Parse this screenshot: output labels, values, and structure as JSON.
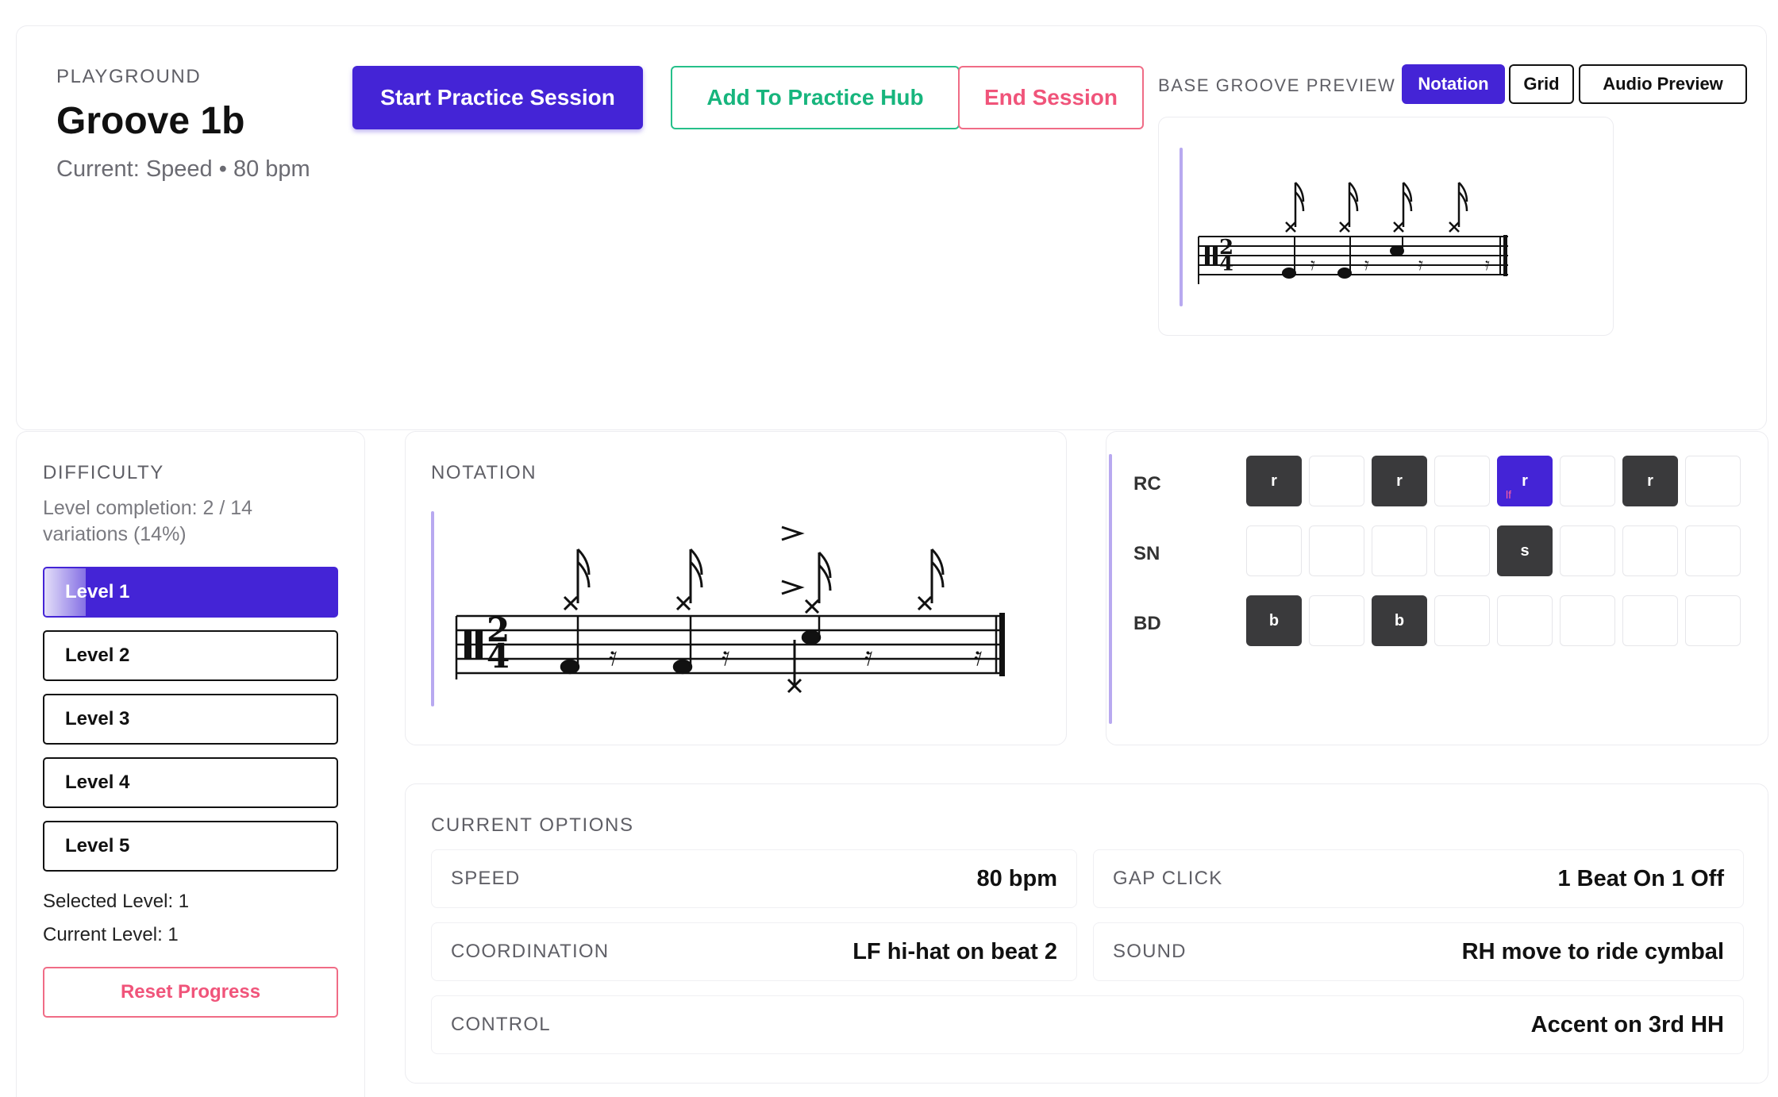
{
  "header": {
    "eyebrow": "PLAYGROUND",
    "title": "Groove 1b",
    "current": "Current: Speed • 80 bpm"
  },
  "actions": {
    "start": "Start Practice Session",
    "add": "Add To Practice Hub",
    "end": "End Session"
  },
  "preview": {
    "label": "BASE GROOVE PREVIEW",
    "modes": [
      "Notation",
      "Grid",
      "Audio Preview"
    ],
    "selected_mode": "Notation",
    "time_signature": "2/4"
  },
  "difficulty": {
    "label": "DIFFICULTY",
    "completion": "Level completion: 2 / 14 variations (14%)",
    "completion_fraction": 0.14,
    "levels": [
      "Level 1",
      "Level 2",
      "Level 3",
      "Level 4",
      "Level 5"
    ],
    "active_level": "Level 1",
    "selected": "Selected Level: 1",
    "current": "Current Level: 1",
    "reset": "Reset Progress"
  },
  "notation": {
    "label": "NOTATION",
    "time_signature": "2/4"
  },
  "grid": {
    "rows": [
      {
        "label": "RC",
        "cells": [
          "r",
          "",
          "r",
          "",
          "r",
          "",
          "r",
          ""
        ],
        "highlight": 4,
        "highlight_sub": "lf"
      },
      {
        "label": "SN",
        "cells": [
          "",
          "",
          "",
          "",
          "s",
          "",
          "",
          ""
        ]
      },
      {
        "label": "BD",
        "cells": [
          "b",
          "",
          "b",
          "",
          "",
          "",
          "",
          ""
        ]
      }
    ]
  },
  "options": {
    "label": "CURRENT OPTIONS",
    "speed": {
      "key": "SPEED",
      "value": "80 bpm"
    },
    "gap_click": {
      "key": "GAP CLICK",
      "value": "1 Beat On 1 Off"
    },
    "coordination": {
      "key": "COORDINATION",
      "value": "LF hi-hat on beat 2"
    },
    "sound": {
      "key": "SOUND",
      "value": "RH move to ride cymbal"
    },
    "control": {
      "key": "CONTROL",
      "value": "Accent on 3rd HH"
    }
  },
  "colors": {
    "primary": "#4424d6",
    "success": "#17b57d",
    "danger": "#f0547a",
    "filled_cell": "#3a3a3c"
  }
}
